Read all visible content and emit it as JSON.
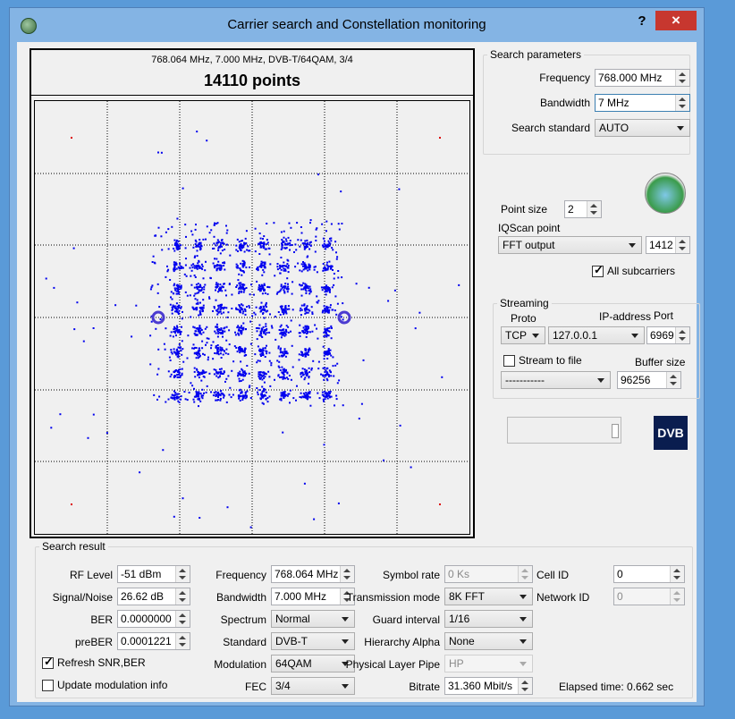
{
  "window": {
    "title": "Carrier search and Constellation monitoring",
    "help": "?",
    "close": "×"
  },
  "plot": {
    "subtitle": "768.064 MHz, 7.000 MHz, DVB-T/64QAM, 3/4",
    "title": "14110 points",
    "colors": {
      "points": "#0000ee",
      "pilots": "#dd0000",
      "grid": "#000000"
    }
  },
  "search_parameters": {
    "title": "Search parameters",
    "frequency_label": "Frequency",
    "frequency": "768.000 MHz",
    "bandwidth_label": "Bandwidth",
    "bandwidth": "7 MHz",
    "standard_label": "Search standard",
    "standard": "AUTO"
  },
  "display": {
    "point_size_label": "Point size",
    "point_size": "2",
    "iqscan_label": "IQScan point",
    "iqscan": "FFT output",
    "iqscan_value": "1412",
    "all_subcarriers_label": "All subcarriers",
    "all_subcarriers_checked": true
  },
  "streaming": {
    "title": "Streaming",
    "proto_label": "Proto",
    "proto": "TCP",
    "ip_label": "IP-address",
    "ip": "127.0.0.1",
    "port_label": "Port",
    "port": "6969",
    "stream_to_file_label": "Stream to file",
    "stream_to_file_checked": false,
    "file": "-----------",
    "buffer_label": "Buffer size",
    "buffer": "96256"
  },
  "logos": {
    "dvb": "DVB",
    "fish": "fish-logo"
  },
  "search_result": {
    "title": "Search result",
    "rf_level_label": "RF Level",
    "rf_level": "-51 dBm",
    "snr_label": "Signal/Noise",
    "snr": "26.62 dB",
    "ber_label": "BER",
    "ber": "0.0000000",
    "preber_label": "preBER",
    "preber": "0.0001221",
    "refresh_label": "Refresh SNR,BER",
    "refresh_checked": true,
    "update_mod_label": "Update modulation info",
    "update_mod_checked": false,
    "frequency_label": "Frequency",
    "frequency": "768.064 MHz",
    "bandwidth_label": "Bandwidth",
    "bandwidth": "7.000 MHz",
    "spectrum_label": "Spectrum",
    "spectrum": "Normal",
    "standard_label": "Standard",
    "standard": "DVB-T",
    "modulation_label": "Modulation",
    "modulation": "64QAM",
    "fec_label": "FEC",
    "fec": "3/4",
    "symbol_rate_label": "Symbol rate",
    "symbol_rate": "0 Ks",
    "tx_mode_label": "Transmission mode",
    "tx_mode": "8K FFT",
    "guard_label": "Guard interval",
    "guard": "1/16",
    "hierarchy_label": "Hierarchy Alpha",
    "hierarchy": "None",
    "plp_label": "Physical Layer Pipe",
    "plp": "HP",
    "bitrate_label": "Bitrate",
    "bitrate": "31.360 Mbit/s",
    "cell_id_label": "Cell ID",
    "cell_id": "0",
    "network_id_label": "Network ID",
    "network_id": "0",
    "elapsed": "Elapsed time: 0.662 sec"
  }
}
